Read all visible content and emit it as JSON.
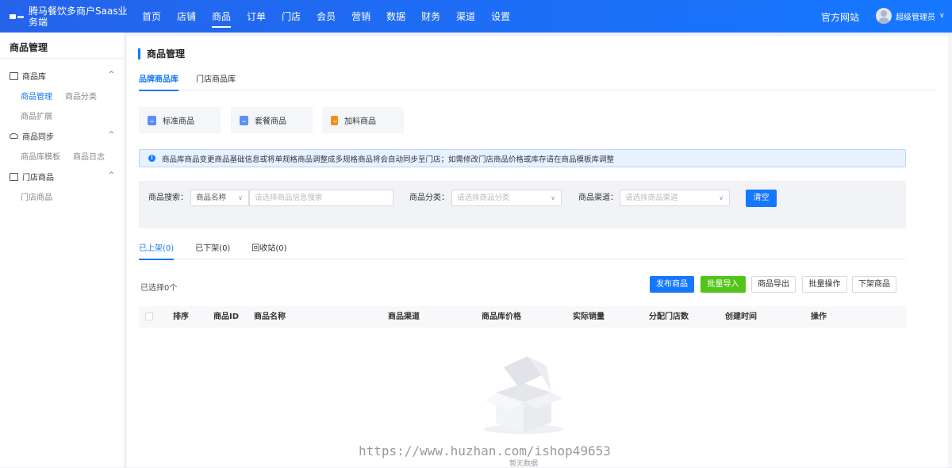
{
  "header": {
    "brand": "腾马餐饮多商户Saas业务端",
    "nav": [
      "首页",
      "店铺",
      "商品",
      "订单",
      "门店",
      "会员",
      "营销",
      "数据",
      "财务",
      "渠道",
      "设置"
    ],
    "active_nav": "商品",
    "site_link": "官方网站",
    "user_name": "超级管理员",
    "user_caret": "∨"
  },
  "sidebar": {
    "title": "商品管理",
    "groups": [
      {
        "label": "商品库",
        "icon": "bag-icon",
        "items": [
          "商品管理",
          "商品分类",
          "商品扩展"
        ],
        "active": "商品管理"
      },
      {
        "label": "商品同步",
        "icon": "cloud-sync-icon",
        "items": [
          "商品库模板",
          "商品日志"
        ]
      },
      {
        "label": "门店商品",
        "icon": "lock-icon",
        "items": [
          "门店商品"
        ]
      }
    ],
    "collapse_glyph": "^"
  },
  "main": {
    "page_title": "商品管理",
    "top_tabs": [
      "品牌商品库",
      "门店商品库"
    ],
    "active_top_tab": "品牌商品库",
    "type_cards": [
      "标准商品",
      "套餐商品",
      "加料商品"
    ],
    "notice": "商品库商品变更商品基础信息或将单规格商品调整成多规格商品将会自动同步至门店；如需修改门店商品价格或库存请在商品模板库调整",
    "notice_icon": "!",
    "filter": {
      "search_label": "商品搜索：",
      "search_field_select": "商品名称",
      "search_placeholder": "请选择商品信息搜索",
      "category_label": "商品分类：",
      "category_placeholder": "请选择商品分类",
      "channel_label": "商品渠道：",
      "channel_placeholder": "请选择商品渠道",
      "clear_button": "清空",
      "chevron": "∨"
    },
    "status_tabs": [
      "已上架(0)",
      "已下架(0)",
      "回收站(0)"
    ],
    "active_status_tab": "已上架(0)",
    "selected_count": "已选择0个",
    "actions": [
      "发布商品",
      "批量导入",
      "商品导出",
      "批量操作",
      "下架商品"
    ],
    "table_headers": [
      "排序",
      "商品ID",
      "商品名称",
      "商品渠道",
      "商品库价格",
      "实际销量",
      "分配门店数",
      "创建时间",
      "操作"
    ],
    "empty_text": "暂无数据",
    "watermark": "https://www.huzhan.com/ishop49653"
  }
}
